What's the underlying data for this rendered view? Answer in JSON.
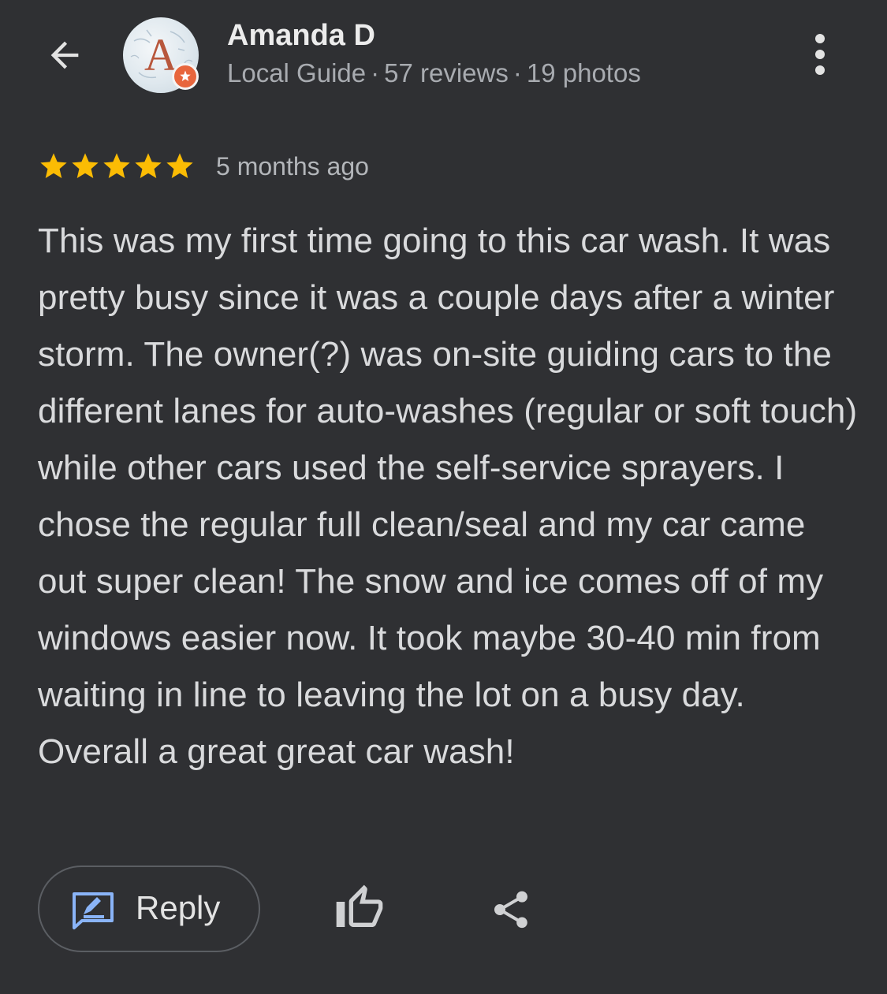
{
  "reviewer": {
    "name": "Amanda D",
    "avatar_letter": "A",
    "badge": "local-guide-badge",
    "meta": {
      "level": "Local Guide",
      "separator": "·",
      "reviews": "57 reviews",
      "photos": "19 photos"
    }
  },
  "header": {
    "back_icon": "arrow-back-icon",
    "more_icon": "more-vertical-icon"
  },
  "rating": {
    "stars": 5,
    "max_stars": 5,
    "star_color": "#fbbc04",
    "time_ago": "5 months ago"
  },
  "review": {
    "text": "This was my first time going to this car wash. It was pretty busy since it was a couple days after a winter storm. The owner(?) was on-site guiding cars to the different lanes for auto-washes (regular or soft touch) while other cars used the self-service sprayers. I chose the regular full clean/seal and my car came out super clean! The snow and ice comes off of my windows easier now. It took maybe 30-40 min from waiting in line to leaving the lot on a busy day. Overall a great great car wash!"
  },
  "actions": {
    "reply_label": "Reply",
    "reply_icon": "rate-review-icon",
    "like_icon": "thumb-up-icon",
    "share_icon": "share-icon",
    "accent_color": "#8ab4f8"
  }
}
